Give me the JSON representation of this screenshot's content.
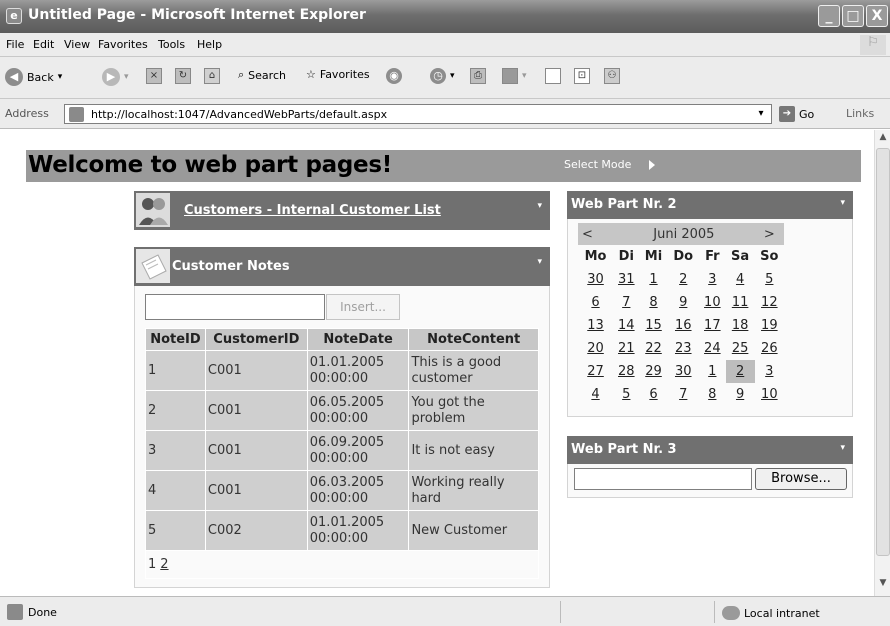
{
  "window": {
    "title": "Untitled Page - Microsoft Internet Explorer",
    "app_icon": "ie-icon",
    "minimize": "_",
    "maximize": "□",
    "close": "X"
  },
  "menu": [
    "File",
    "Edit",
    "View",
    "Favorites",
    "Tools",
    "Help"
  ],
  "toolbar": {
    "back": "Back",
    "search": "Search",
    "favorites": "Favorites"
  },
  "address": {
    "label": "Address",
    "url": "http://localhost:1047/AdvancedWebParts/default.aspx",
    "go": "Go",
    "links": "Links"
  },
  "page": {
    "heading": "Welcome to web part pages!",
    "select_mode": "Select Mode"
  },
  "customers_part": {
    "title": "Customers - Internal Customer List",
    "verbs": "▾"
  },
  "notes_part": {
    "title": "Customer Notes",
    "verbs": "▾",
    "insert_label": "Insert...",
    "columns": [
      "NoteID",
      "CustomerID",
      "NoteDate",
      "NoteContent"
    ],
    "rows": [
      {
        "id": "1",
        "customer": "C001",
        "date": "01.01.2005 00:00:00",
        "content": "This is a good customer"
      },
      {
        "id": "2",
        "customer": "C001",
        "date": "06.05.2005 00:00:00",
        "content": "You got the problem"
      },
      {
        "id": "3",
        "customer": "C001",
        "date": "06.09.2005 00:00:00",
        "content": "It is not easy"
      },
      {
        "id": "4",
        "customer": "C001",
        "date": "06.03.2005 00:00:00",
        "content": "Working really hard"
      },
      {
        "id": "5",
        "customer": "C002",
        "date": "01.01.2005 00:00:00",
        "content": "New Customer"
      }
    ],
    "pager": {
      "current": "1",
      "next": "2"
    }
  },
  "web_part_2": {
    "title": "Web Part Nr. 2",
    "verbs": "▾",
    "calendar": {
      "prev": "<",
      "month": "Juni 2005",
      "next": ">",
      "days_of_week": [
        "Mo",
        "Di",
        "Mi",
        "Do",
        "Fr",
        "Sa",
        "So"
      ],
      "weeks": [
        [
          "30",
          "31",
          "1",
          "2",
          "3",
          "4",
          "5"
        ],
        [
          "6",
          "7",
          "8",
          "9",
          "10",
          "11",
          "12"
        ],
        [
          "13",
          "14",
          "15",
          "16",
          "17",
          "18",
          "19"
        ],
        [
          "20",
          "21",
          "22",
          "23",
          "24",
          "25",
          "26"
        ],
        [
          "27",
          "28",
          "29",
          "30",
          "1",
          "2",
          "3"
        ],
        [
          "4",
          "5",
          "6",
          "7",
          "8",
          "9",
          "10"
        ]
      ],
      "selected": "2"
    }
  },
  "web_part_3": {
    "title": "Web Part Nr. 3",
    "verbs": "▾",
    "browse_label": "Browse..."
  },
  "status": {
    "text": "Done",
    "zone": "Local intranet"
  }
}
